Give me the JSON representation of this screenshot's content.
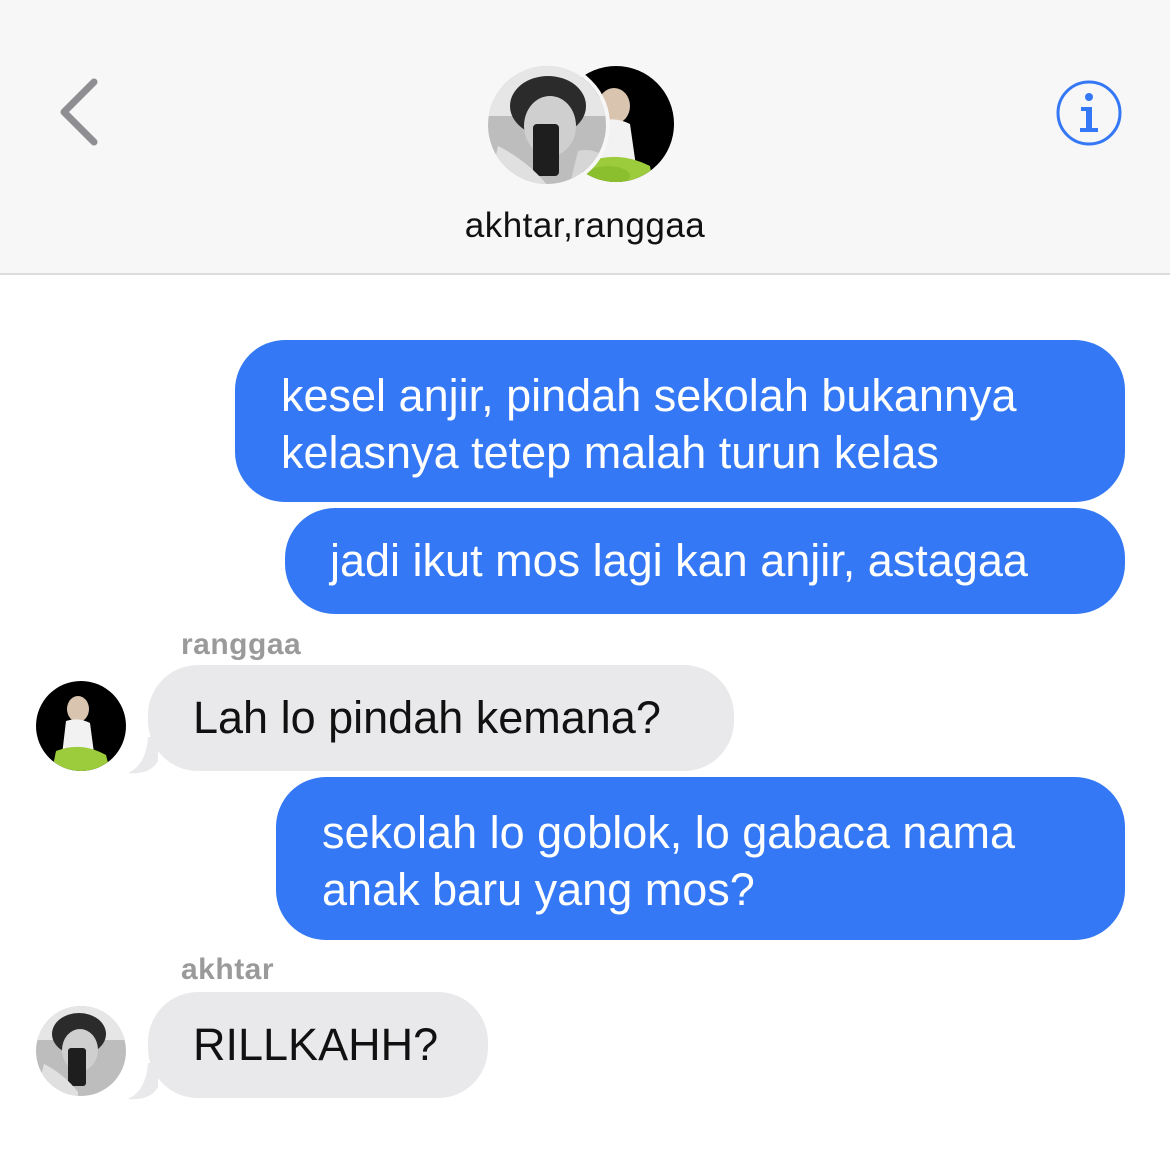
{
  "header": {
    "title": "akhtar,ranggaa",
    "back_icon": "chevron-left-icon",
    "info_icon": "info-icon",
    "accent_color": "#3478f6"
  },
  "messages": [
    {
      "sender": "",
      "direction": "outgoing",
      "lines": [
        "kesel anjir, pindah sekolah bukannya",
        "kelasnya tetep malah turun kelas"
      ]
    },
    {
      "sender": "",
      "direction": "outgoing",
      "lines": [
        "jadi ikut mos lagi kan anjir, astagaa"
      ]
    },
    {
      "sender": "ranggaa",
      "direction": "incoming",
      "lines": [
        "Lah lo pindah kemana?"
      ]
    },
    {
      "sender": "",
      "direction": "outgoing",
      "lines": [
        "sekolah lo goblok, lo gabaca nama",
        "anak baru yang mos?"
      ]
    },
    {
      "sender": "akhtar",
      "direction": "incoming",
      "lines": [
        "RILLKAHH?"
      ]
    }
  ],
  "colors": {
    "outgoing_bubble": "#3478f6",
    "incoming_bubble": "#e9e9eb",
    "header_bg": "#f7f7f7"
  }
}
